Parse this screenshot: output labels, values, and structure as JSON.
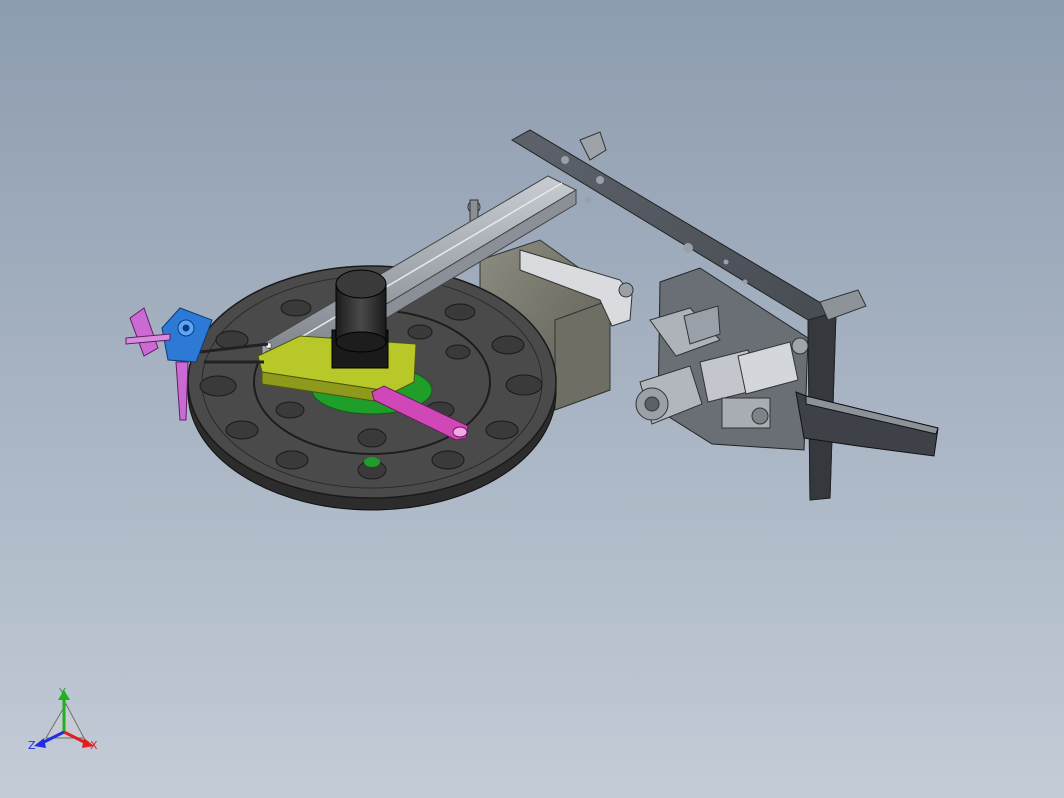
{
  "viewport": {
    "background_top": "#8d9caf",
    "background_bottom": "#c3ccd7"
  },
  "triad": {
    "x_label": "X",
    "y_label": "Y",
    "z_label": "Z",
    "x_color": "#e02020",
    "y_color": "#20b020",
    "z_color": "#2030e0"
  },
  "model": {
    "icon": "cad-assembly-model"
  }
}
